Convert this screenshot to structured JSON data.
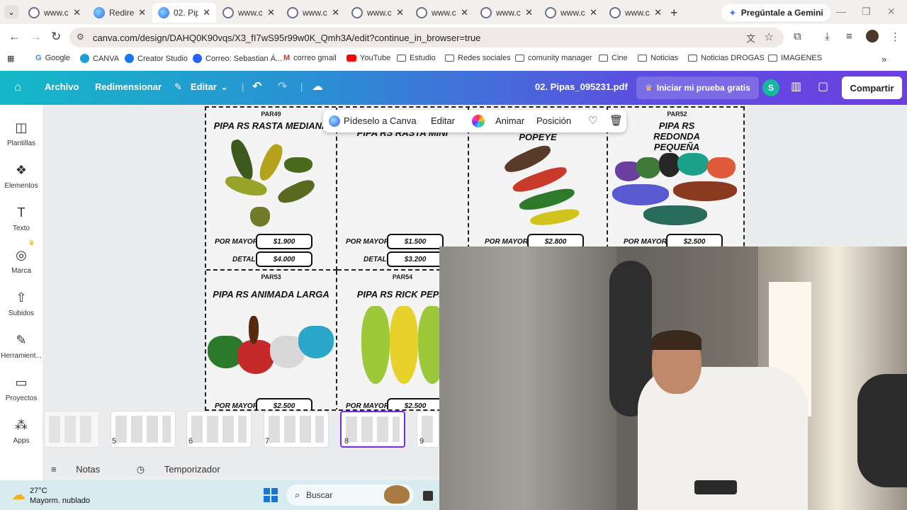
{
  "browser": {
    "tabs": [
      {
        "title": "www.ca",
        "active": false
      },
      {
        "title": "Redirec",
        "active": false
      },
      {
        "title": "02. Pip",
        "active": true
      },
      {
        "title": "www.ca",
        "active": false
      },
      {
        "title": "www.ca",
        "active": false
      },
      {
        "title": "www.ca",
        "active": false
      },
      {
        "title": "www.ca",
        "active": false
      },
      {
        "title": "www.ca",
        "active": false
      },
      {
        "title": "www.ca",
        "active": false
      },
      {
        "title": "www.ca",
        "active": false
      }
    ],
    "gemini_label": "Pregúntale a Gemini",
    "url": "canva.com/design/DAHQ0K90vqs/X3_fI7wS95r99w0K_Qmh3A/edit?continue_in_browser=true",
    "bookmarks": [
      {
        "label": "Google",
        "icon": "google-icon"
      },
      {
        "label": "CANVA",
        "icon": "canva-icon"
      },
      {
        "label": "Creator Studio",
        "icon": "facebook-icon"
      },
      {
        "label": "Correo: Sebastian Á...",
        "icon": "outlook-icon"
      },
      {
        "label": "correo gmail",
        "icon": "gmail-icon"
      },
      {
        "label": "YouTube",
        "icon": "youtube-icon"
      },
      {
        "label": "Estudio",
        "icon": "folder-icon"
      },
      {
        "label": "Redes sociales",
        "icon": "folder-icon"
      },
      {
        "label": "comunity manager",
        "icon": "folder-icon"
      },
      {
        "label": "Cine",
        "icon": "folder-icon"
      },
      {
        "label": "Noticias",
        "icon": "folder-icon"
      },
      {
        "label": "Noticias DROGAS",
        "icon": "folder-icon"
      },
      {
        "label": "IMAGENES",
        "icon": "folder-icon"
      }
    ]
  },
  "canva": {
    "header": {
      "archivo": "Archivo",
      "redimensionar": "Redimensionar",
      "editar": "Editar",
      "doc_title": "02. Pipas_095231.pdf",
      "trial": "Iniciar mi prueba gratis",
      "avatar_initial": "S",
      "share": "Compartir"
    },
    "rail": [
      {
        "label": "Plantillas",
        "icon": "templates-icon"
      },
      {
        "label": "Elementos",
        "icon": "elements-icon"
      },
      {
        "label": "Texto",
        "icon": "text-icon"
      },
      {
        "label": "Marca",
        "icon": "brand-icon"
      },
      {
        "label": "Subidos",
        "icon": "upload-icon"
      },
      {
        "label": "Herramient...",
        "icon": "tools-icon"
      },
      {
        "label": "Proyectos",
        "icon": "folder-icon"
      },
      {
        "label": "Apps",
        "icon": "apps-icon"
      }
    ],
    "float_bar": {
      "ask": "Pídeselo a Canva",
      "edit": "Editar",
      "animate": "Animar",
      "position": "Posición"
    },
    "products": [
      {
        "code": "PAR49",
        "name": "PIPA RS RASTA MEDIANA",
        "mayor": "$1.900",
        "detal": "$4.000"
      },
      {
        "code": "",
        "name": "PIPA RS RASTA MINI",
        "mayor": "$1.500",
        "detal": "$3.200"
      },
      {
        "code": "",
        "name": "POPEYE",
        "mayor": "$2.800",
        "detal": ""
      },
      {
        "code": "PAR52",
        "name": "PIPA RS REDONDA PEQUEÑA",
        "mayor": "$2.500",
        "detal": ""
      },
      {
        "code": "PAR53",
        "name": "PIPA RS ANIMADA LARGA",
        "mayor": "$2.500",
        "detal": ""
      },
      {
        "code": "PAR54",
        "name": "PIPA RS RICK PEPIN",
        "mayor": "$2.500",
        "detal": ""
      }
    ],
    "labels": {
      "por_mayor": "POR MAYOR",
      "detal": "DETAL"
    },
    "page_numbers": [
      "5",
      "6",
      "7",
      "8",
      "9"
    ],
    "bottom": {
      "notes": "Notas",
      "timer": "Temporizador"
    }
  },
  "taskbar": {
    "temp": "27°C",
    "weather": "Mayorm. nublado",
    "search": "Buscar"
  }
}
